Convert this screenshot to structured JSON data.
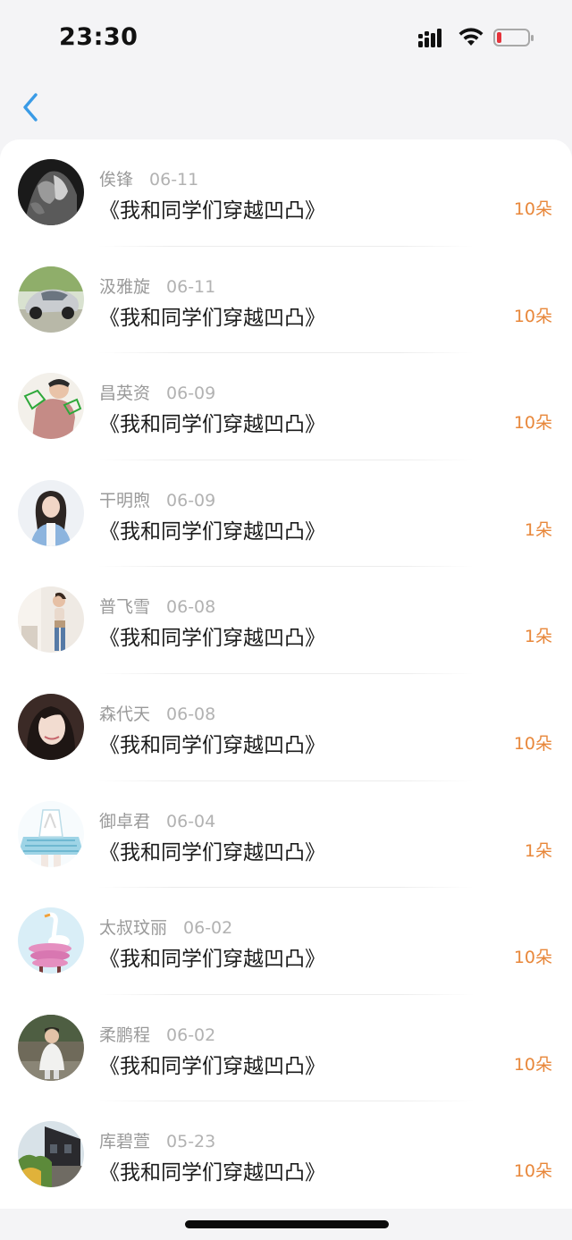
{
  "status_bar": {
    "time": "23:30",
    "icons": [
      "signal-icon",
      "wifi-icon",
      "battery-low-icon"
    ]
  },
  "nav": {
    "back_icon": "chevron-left-icon",
    "accent_color": "#3a9be6"
  },
  "colors": {
    "amount": "#e8873a",
    "name": "#9a9a9a",
    "title": "#1c1c1c"
  },
  "items": [
    {
      "name": "俟锋",
      "date": "06-11",
      "title": "《我和同学们穿越凹凸》",
      "amount": "10朵"
    },
    {
      "name": "汲雅旋",
      "date": "06-11",
      "title": "《我和同学们穿越凹凸》",
      "amount": "10朵"
    },
    {
      "name": "昌英资",
      "date": "06-09",
      "title": "《我和同学们穿越凹凸》",
      "amount": "10朵"
    },
    {
      "name": "干明煦",
      "date": "06-09",
      "title": "《我和同学们穿越凹凸》",
      "amount": "1朵"
    },
    {
      "name": "普飞雪",
      "date": "06-08",
      "title": "《我和同学们穿越凹凸》",
      "amount": "1朵"
    },
    {
      "name": "森代天",
      "date": "06-08",
      "title": "《我和同学们穿越凹凸》",
      "amount": "10朵"
    },
    {
      "name": "御卓君",
      "date": "06-04",
      "title": "《我和同学们穿越凹凸》",
      "amount": "1朵"
    },
    {
      "name": "太叔玟丽",
      "date": "06-02",
      "title": "《我和同学们穿越凹凸》",
      "amount": "10朵"
    },
    {
      "name": "柔鹏程",
      "date": "06-02",
      "title": "《我和同学们穿越凹凸》",
      "amount": "10朵"
    },
    {
      "name": "库碧萱",
      "date": "05-23",
      "title": "《我和同学们穿越凹凸》",
      "amount": "10朵"
    }
  ]
}
